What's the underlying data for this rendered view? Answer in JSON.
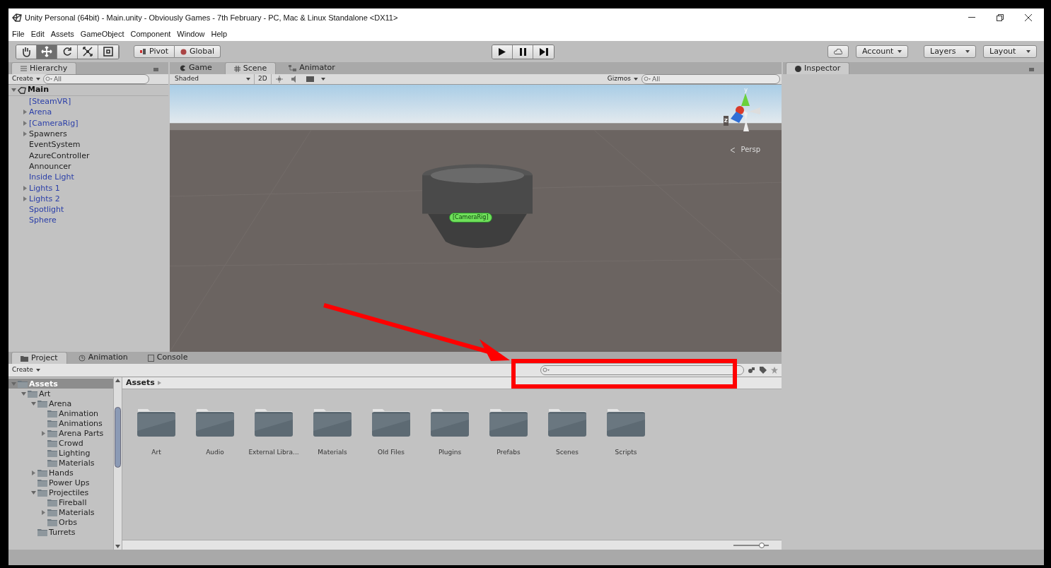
{
  "window": {
    "title": "Unity Personal (64bit) - Main.unity - Obviously Games - 7th February - PC, Mac & Linux Standalone <DX11>"
  },
  "menu": [
    "File",
    "Edit",
    "Assets",
    "GameObject",
    "Component",
    "Window",
    "Help"
  ],
  "toolbar": {
    "tools": [
      {
        "kind": "hand",
        "selected": false
      },
      {
        "kind": "move",
        "selected": true
      },
      {
        "kind": "rotate",
        "selected": false
      },
      {
        "kind": "scale",
        "selected": false
      },
      {
        "kind": "rect",
        "selected": false
      }
    ],
    "pivot": "Pivot",
    "global": "Global",
    "account": "Account",
    "layers": "Layers",
    "layout": "Layout"
  },
  "hierarchy": {
    "tab": {
      "label": "Hierarchy",
      "selected": true
    },
    "create": "Create",
    "search_placeholder": "All",
    "scene": "Main",
    "items": [
      {
        "label": "[SteamVR]",
        "kind": "prefab"
      },
      {
        "label": "Arena",
        "kind": "prefab",
        "expanded": false
      },
      {
        "label": "[CameraRig]",
        "kind": "prefab",
        "expanded": false
      },
      {
        "label": "Spawners",
        "kind": "object",
        "expanded": false
      },
      {
        "label": "EventSystem",
        "kind": "object"
      },
      {
        "label": "AzureController",
        "kind": "object"
      },
      {
        "label": "Announcer",
        "kind": "object"
      },
      {
        "label": "Inside Light",
        "kind": "prefab"
      },
      {
        "label": "Lights 1",
        "kind": "prefab",
        "expanded": false
      },
      {
        "label": "Lights 2",
        "kind": "prefab",
        "expanded": false
      },
      {
        "label": "Spotlight",
        "kind": "prefab"
      },
      {
        "label": "Sphere",
        "kind": "prefab"
      }
    ]
  },
  "view_tabs": [
    {
      "label": "Game",
      "kind": "game",
      "selected": false
    },
    {
      "label": "Scene",
      "kind": "scene",
      "selected": true
    },
    {
      "label": "Animator",
      "kind": "animator",
      "selected": false
    }
  ],
  "scene": {
    "shading": "Shaded",
    "mode_2d": "2D",
    "gizmos": "Gizmos",
    "search_placeholder": "All",
    "object_label": "[CameraRig]",
    "axis_labels": [
      "y",
      "z"
    ],
    "projection": "Persp"
  },
  "inspector": {
    "tab": {
      "label": "Inspector",
      "selected": true
    }
  },
  "project": {
    "tabs": [
      {
        "label": "Project",
        "kind": "project",
        "selected": true
      },
      {
        "label": "Animation",
        "kind": "animation",
        "selected": false
      },
      {
        "label": "Console",
        "kind": "console",
        "selected": false
      }
    ],
    "create": "Create",
    "tree": [
      {
        "label": "Assets",
        "selected": true,
        "expanded": true,
        "children": [
          {
            "label": "Art",
            "selected": false,
            "expanded": true,
            "children": [
              {
                "label": "Arena",
                "selected": false,
                "expanded": true,
                "children": [
                  {
                    "label": "Animation",
                    "selected": false
                  },
                  {
                    "label": "Animations",
                    "selected": false
                  },
                  {
                    "label": "Arena Parts",
                    "selected": false,
                    "expanded": false
                  },
                  {
                    "label": "Crowd",
                    "selected": false
                  },
                  {
                    "label": "Lighting",
                    "selected": false
                  },
                  {
                    "label": "Materials",
                    "selected": false
                  }
                ]
              },
              {
                "label": "Hands",
                "selected": false,
                "expanded": false
              },
              {
                "label": "Power Ups",
                "selected": false
              },
              {
                "label": "Projectiles",
                "selected": false,
                "expanded": true,
                "children": [
                  {
                    "label": "Fireball",
                    "selected": false
                  },
                  {
                    "label": "Materials",
                    "selected": false,
                    "expanded": false
                  },
                  {
                    "label": "Orbs",
                    "selected": false
                  }
                ]
              },
              {
                "label": "Turrets",
                "selected": false
              }
            ]
          }
        ]
      }
    ],
    "breadcrumb": "Assets",
    "folders": [
      "Art",
      "Audio",
      "External Libra...",
      "Materials",
      "Old Files",
      "Plugins",
      "Prefabs",
      "Scenes",
      "Scripts"
    ],
    "icon_size": {
      "level": 0.8
    }
  }
}
